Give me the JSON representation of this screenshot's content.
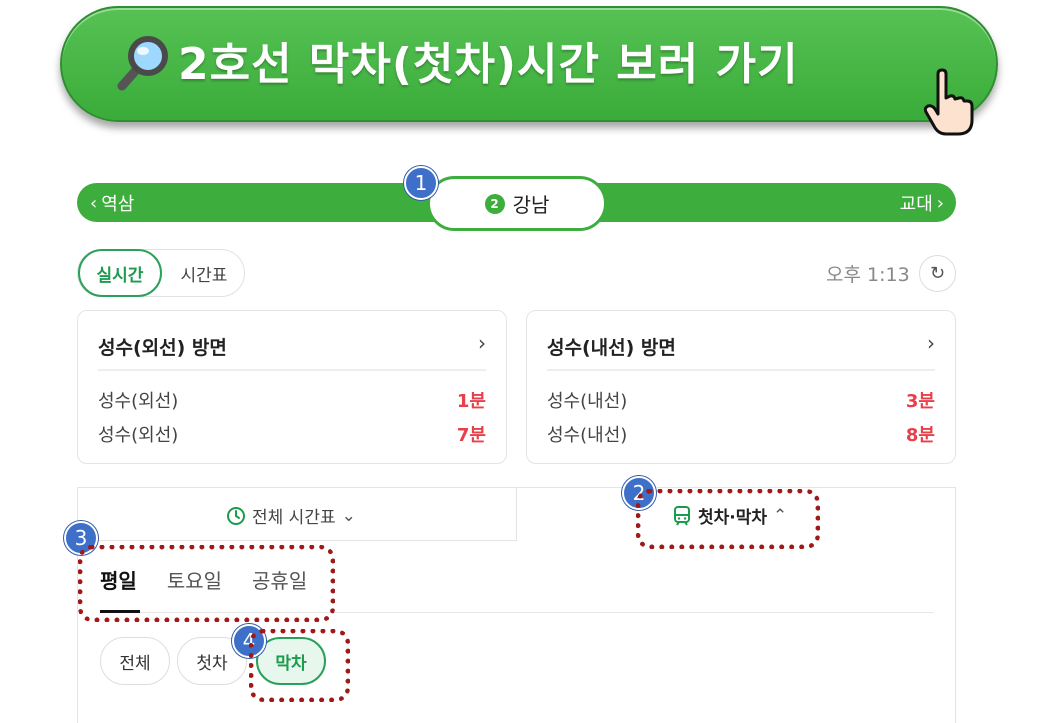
{
  "banner": {
    "title": "2호선 막차(첫차)시간 보러 가기"
  },
  "station": {
    "prev": "역삼",
    "current": "강남",
    "next": "교대",
    "line_number": "2"
  },
  "annotations": [
    "1",
    "2",
    "3",
    "4"
  ],
  "mode_tabs": {
    "active": "실시간",
    "inactive": "시간표"
  },
  "clock": {
    "time": "오후 1:13"
  },
  "cards": [
    {
      "title": "성수(외선) 방면",
      "rows": [
        {
          "dest": "성수(외선)",
          "mins": "1분"
        },
        {
          "dest": "성수(외선)",
          "mins": "7분"
        }
      ]
    },
    {
      "title": "성수(내선) 방면",
      "rows": [
        {
          "dest": "성수(내선)",
          "mins": "3분"
        },
        {
          "dest": "성수(내선)",
          "mins": "8분"
        }
      ]
    }
  ],
  "panel": {
    "full_timetable": "전체 시간표",
    "first_last": "첫차·막차",
    "day_tabs": [
      "평일",
      "토요일",
      "공휴일"
    ],
    "filters": [
      "전체",
      "첫차",
      "막차"
    ]
  },
  "colors": {
    "line2_green": "#3dae3d",
    "accent_green": "#1c9a4e",
    "arrival_red": "#e8404a",
    "badge_blue": "#3e6fc9",
    "highlight_red": "#a01818"
  },
  "icons": [
    "magnifier-icon",
    "pointer-hand-icon",
    "chevron-left-icon",
    "chevron-right-icon",
    "refresh-icon",
    "clock-icon",
    "train-icon",
    "chevron-down-icon",
    "chevron-up-icon"
  ]
}
